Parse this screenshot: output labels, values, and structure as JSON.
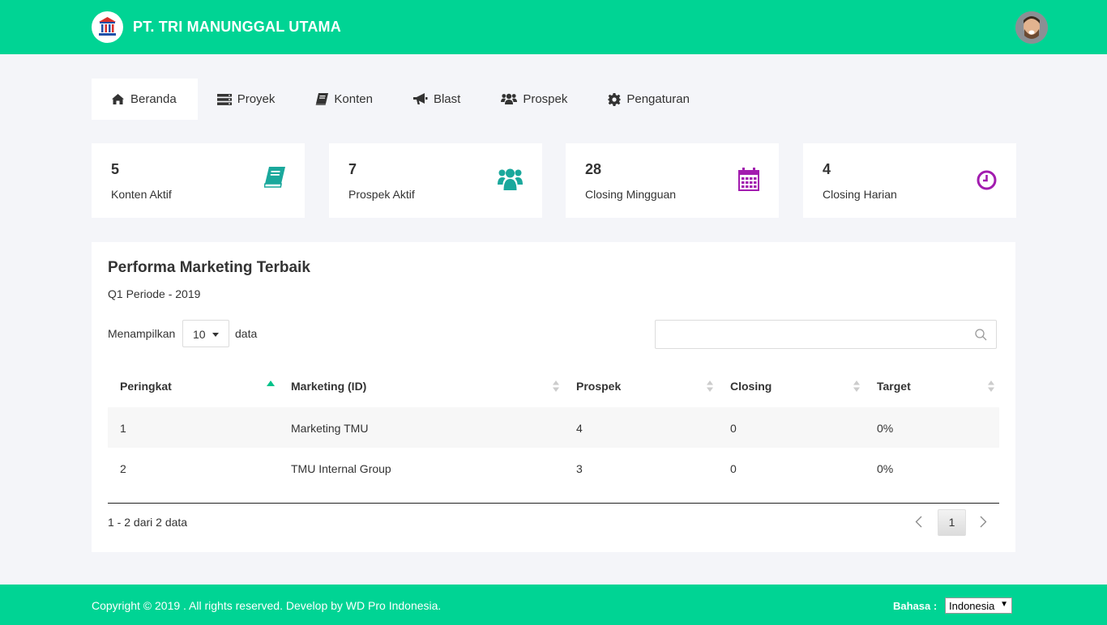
{
  "header": {
    "brand": "PT. TRI MANUNGGAL UTAMA",
    "brand_color": "#00d494"
  },
  "nav": {
    "items": [
      {
        "label": "Beranda",
        "icon": "home-icon",
        "active": true
      },
      {
        "label": "Proyek",
        "icon": "server-icon"
      },
      {
        "label": "Konten",
        "icon": "book-icon"
      },
      {
        "label": "Blast",
        "icon": "bullhorn-icon"
      },
      {
        "label": "Prospek",
        "icon": "users-icon"
      },
      {
        "label": "Pengaturan",
        "icon": "gear-icon"
      }
    ]
  },
  "stats": [
    {
      "value": "5",
      "label": "Konten Aktif",
      "icon": "book-icon",
      "color": "#1aa89c"
    },
    {
      "value": "7",
      "label": "Prospek Aktif",
      "icon": "users-icon",
      "color": "#1aa89c"
    },
    {
      "value": "28",
      "label": "Closing Mingguan",
      "icon": "calendar-icon",
      "color": "#a21caf"
    },
    {
      "value": "4",
      "label": "Closing Harian",
      "icon": "clock-icon",
      "color": "#a21caf"
    }
  ],
  "panel": {
    "title": "Performa Marketing Terbaik",
    "subtitle": "Q1 Periode - 2019",
    "show_label": "Menampilkan",
    "page_size": "10",
    "data_label": "data",
    "search_placeholder": ""
  },
  "table": {
    "columns": [
      "Peringkat",
      "Marketing (ID)",
      "Prospek",
      "Closing",
      "Target"
    ],
    "rows": [
      [
        "1",
        "Marketing TMU",
        "4",
        "0",
        "0%"
      ],
      [
        "2",
        "TMU Internal Group",
        "3",
        "0",
        "0%"
      ]
    ]
  },
  "pagination": {
    "info": "1 - 2 dari 2 data",
    "current_page": "1"
  },
  "footer": {
    "copyright": "Copyright © 2019 . All rights reserved. Develop by WD Pro Indonesia.",
    "language_label": "Bahasa :",
    "language_value": "Indonesia"
  }
}
